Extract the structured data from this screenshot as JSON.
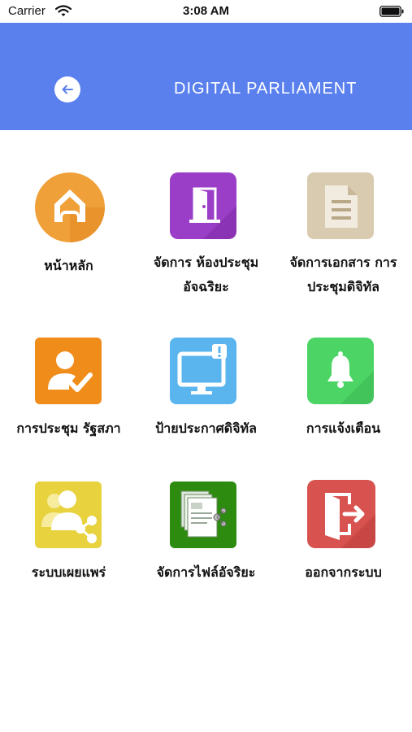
{
  "status_bar": {
    "carrier": "Carrier",
    "time": "3:08 AM"
  },
  "header": {
    "title": "DIGITAL  PARLIAMENT",
    "color": "#5a80ee"
  },
  "menu": [
    {
      "label": "หน้าหลัก",
      "icon": "home-icon",
      "color": "#f0a038"
    },
    {
      "label": "จัดการ ห้องประชุม\nอัจฉริยะ",
      "icon": "door-icon",
      "color": "#9b3ec7"
    },
    {
      "label": "จัดการเอกสาร การ\nประชุมดิจิทัล",
      "icon": "document-icon",
      "color": "#d9cbb0"
    },
    {
      "label": "การประชุม รัฐสภา",
      "icon": "user-check-icon",
      "color": "#f08c1a"
    },
    {
      "label": "ป้ายประกาศดิจิทัล",
      "icon": "monitor-alert-icon",
      "color": "#5ab4ee"
    },
    {
      "label": "การแจ้งเตือน",
      "icon": "bell-icon",
      "color": "#4cd464"
    },
    {
      "label": "ระบบเผยแพร่",
      "icon": "share-users-icon",
      "color": "#e8d23e"
    },
    {
      "label": "จัดการไฟล์อัจริยะ",
      "icon": "file-share-icon",
      "color": "#2d8c10"
    },
    {
      "label": "ออกจากระบบ",
      "icon": "logout-icon",
      "color": "#d85250"
    }
  ]
}
